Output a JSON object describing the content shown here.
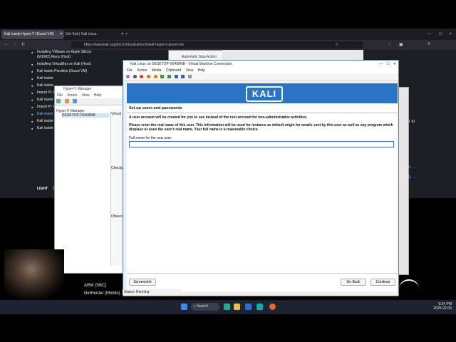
{
  "browser": {
    "tabs": [
      "Kali inside Hyper-V (Guest VM)",
      "Get Kali | Kali Linux"
    ],
    "url": "https://www.kali.org/docs/virtualization/install-hyper-v-guest-vm/"
  },
  "docs_nav": {
    "items": [
      "Installing VMware on Apple Silicon (M1/M2) Macs (Host)",
      "Installing VirtualBox on Kali (Host)",
      "Kali inside Parallels (Guest VM)",
      "Kali inside",
      "Kali inside",
      "Import Pr VM",
      "Kali inside VM)",
      "Import Pr VirtualBox",
      "Kali inside",
      "Kali inside",
      "Kali inside virt-manag"
    ],
    "theme_label": "LIGHT",
    "right_text_1": "t to",
    "right_link": "ge →",
    "right_text_2": "M) →"
  },
  "popup": {
    "title": "Automatic Stop Action"
  },
  "hyperv": {
    "title": "Hyper-V Manager",
    "menu": [
      "File",
      "Action",
      "View",
      "Help"
    ],
    "tree_root": "Hyper-V Manager",
    "tree_node": "DESKTOP-X5408NB",
    "pane_virtual": "Virtual",
    "pane_checkpoints": "Checkp",
    "pane_observed": "Observ",
    "status": "Status: Running"
  },
  "vm": {
    "title": "Kali Linux on DESKTOP-X5408NB - Virtual Machine Connection",
    "menu": [
      "File",
      "Action",
      "Media",
      "Clipboard",
      "View",
      "Help"
    ],
    "logo": "KALI",
    "installer": {
      "heading": "Set up users and passwords",
      "line1": "A user account will be created for you to use instead of the root account for non-administrative activities.",
      "line2": "Please enter the real name of this user. This information will be used for instance as default origin for emails sent by this user as well as any program which displays or uses the user's real name. Your full name is a reasonable choice.",
      "field_label": "Full name for the new user:",
      "field_value": "",
      "screenshot_button": "Screenshot",
      "back_button": "Go Back",
      "continue_button": "Continue"
    }
  },
  "desktop_list": [
    "ARM (SBC)",
    "NetHunter (Mobile)"
  ],
  "taskbar": {
    "search": "Search",
    "time": "9:24 PM",
    "date": "2025-02-06"
  },
  "colors": {
    "kali_blue": "#2a74c5",
    "browser_bg": "#1c1b22"
  }
}
